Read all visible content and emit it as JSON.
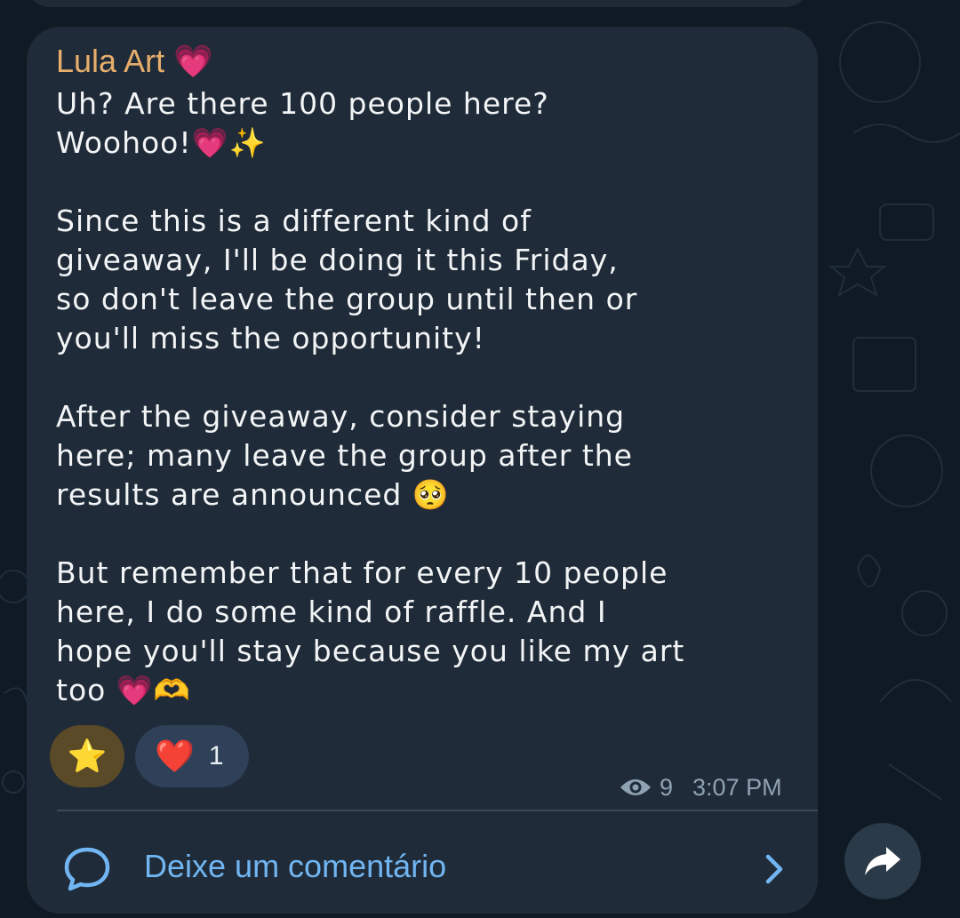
{
  "post": {
    "author": "Lula Art",
    "author_emoji": "💗",
    "paragraphs": [
      [
        "Uh? Are there 100 people here?",
        "Woohoo!💗✨"
      ],
      [
        "Since this is a different kind of",
        "giveaway, I'll be doing it this Friday,",
        "so don't leave the group until then or",
        "you'll miss the opportunity!"
      ],
      [
        "After the giveaway, consider staying",
        "here; many leave the group after the",
        "results are announced 🥺"
      ],
      [
        "But remember that for every 10 people",
        "here, I do some kind of raffle. And I",
        "hope you'll stay because you like my art",
        "too 💗🫶"
      ]
    ],
    "reactions": [
      {
        "emoji": "⭐",
        "count": ""
      },
      {
        "emoji": "❤️",
        "count": "1"
      }
    ],
    "views": "9",
    "time": "3:07 PM"
  },
  "comments": {
    "label": "Deixe um comentário"
  },
  "icons": {
    "views": "eye-icon",
    "comment": "speech-bubble-icon",
    "chevron": "chevron-right-icon",
    "share": "share-arrow-icon"
  },
  "colors": {
    "background": "#0f1a24",
    "bubble": "#1f2b38",
    "author": "#e6ad6b",
    "link": "#71b6f2",
    "meta": "#8fa2b3"
  }
}
